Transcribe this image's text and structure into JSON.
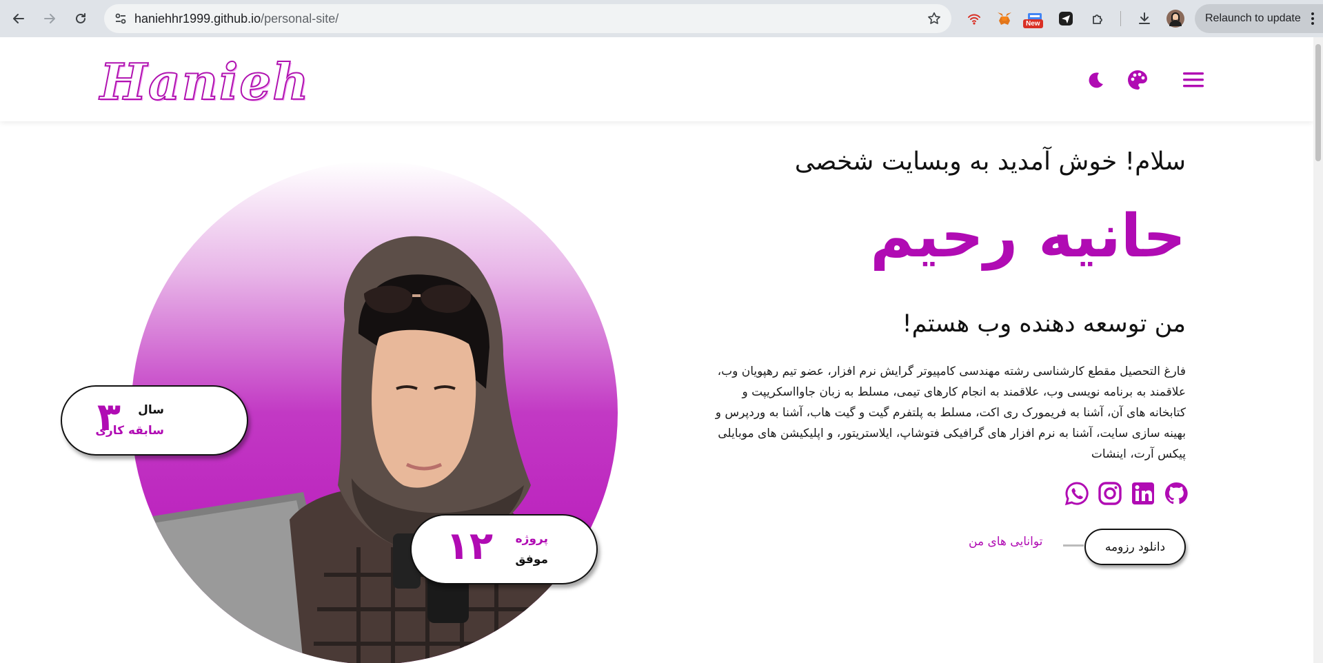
{
  "browser": {
    "url_host": "haniehhr1999.github.io",
    "url_path": "/personal-site/",
    "new_badge": "New",
    "relaunch_label": "Relaunch to update"
  },
  "header": {
    "logo_text": "Hanieh",
    "accent_color": "#b00bb3"
  },
  "hero": {
    "greeting": "سلام! خوش آمدید به وبسایت شخصی",
    "name": "حانیه رحیم",
    "role": "من توسعه دهنده وب هستم!",
    "bio_lines": [
      "فارغ التحصیل مقطع کارشناسی رشته مهندسی کامپیوتر گرایش نرم افزار، عضو تیم رهپویان وب،",
      "علاقمند به برنامه نویسی وب، علاقمند به انجام کارهای تیمی، مسلط به زبان جاوااسکریپت و",
      "کتابخانه های آن، آشنا به فریمورک ری اکت، مسلط به پلتفرم گیت و گیت هاب، آشنا به وردپرس و",
      "بهینه سازی سایت، آشنا به نرم افزار های گرافیکی فتوشاپ، ایلاستریتور، و اپلیکیشن های موبایلی",
      "پیکس آرت، اینشات"
    ],
    "skills_link": "توانایی های من",
    "resume_button": "دانلود رزومه"
  },
  "stats": {
    "experience": {
      "number": "۳",
      "line1": "سال",
      "line2": "سابقه کاری"
    },
    "projects": {
      "number": "۱۲",
      "line1": "پروژه",
      "line2": "موفق"
    }
  },
  "icons": {
    "header": [
      "moon-icon",
      "palette-icon",
      "hamburger-menu-icon"
    ],
    "socials": [
      "whatsapp-icon",
      "instagram-icon",
      "linkedin-icon",
      "github-icon"
    ]
  }
}
